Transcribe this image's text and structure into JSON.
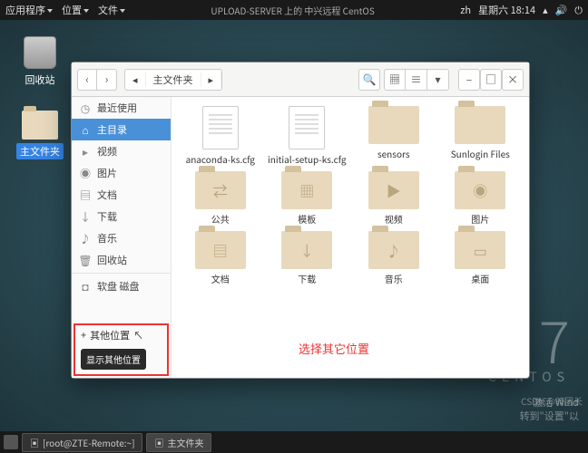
{
  "panel": {
    "apps": "应用程序",
    "places": "位置",
    "files": "文件",
    "title": "UPLOAD-SERVER 上的 中兴远程 CentOS",
    "lang": "zh",
    "clock": "星期六 18:14"
  },
  "desktop": {
    "trash": "回收站",
    "home": "主文件夹",
    "centos_num": "7",
    "centos_word": "CENTOS",
    "activate1": "激活 Wind",
    "activate2": "转到\"设置\"以"
  },
  "fm": {
    "path_root": "◂",
    "path_home": "主文件夹",
    "path_next": "▸",
    "sidebar": {
      "recent": "最近使用",
      "home": "主目录",
      "videos": "视频",
      "pictures": "图片",
      "documents": "文档",
      "downloads": "下载",
      "music": "音乐",
      "trash": "回收站",
      "disk": "软盘 磁盘",
      "other": "其他位置",
      "tooltip": "显示其他位置"
    },
    "items": [
      {
        "type": "file",
        "label": "anaconda-ks.cfg"
      },
      {
        "type": "file",
        "label": "initial-setup-ks.cfg"
      },
      {
        "type": "folder",
        "label": "sensors",
        "glyph": ""
      },
      {
        "type": "folder",
        "label": "Sunlogin Files",
        "glyph": ""
      },
      {
        "type": "folder",
        "label": "公共",
        "glyph": "⇄"
      },
      {
        "type": "folder",
        "label": "模板",
        "glyph": "▦"
      },
      {
        "type": "folder",
        "label": "视频",
        "glyph": "▶"
      },
      {
        "type": "folder",
        "label": "图片",
        "glyph": "◉"
      },
      {
        "type": "folder",
        "label": "文档",
        "glyph": "▤"
      },
      {
        "type": "folder",
        "label": "下载",
        "glyph": "↓"
      },
      {
        "type": "folder",
        "label": "音乐",
        "glyph": "♪"
      },
      {
        "type": "folder",
        "label": "桌面",
        "glyph": "▭"
      }
    ],
    "annotation": "选择其它位置"
  },
  "taskbar": {
    "term": "[root@ZTE-Remote:~]",
    "fm": "主文件夹"
  },
  "watermark": "CSDN @骑团长"
}
